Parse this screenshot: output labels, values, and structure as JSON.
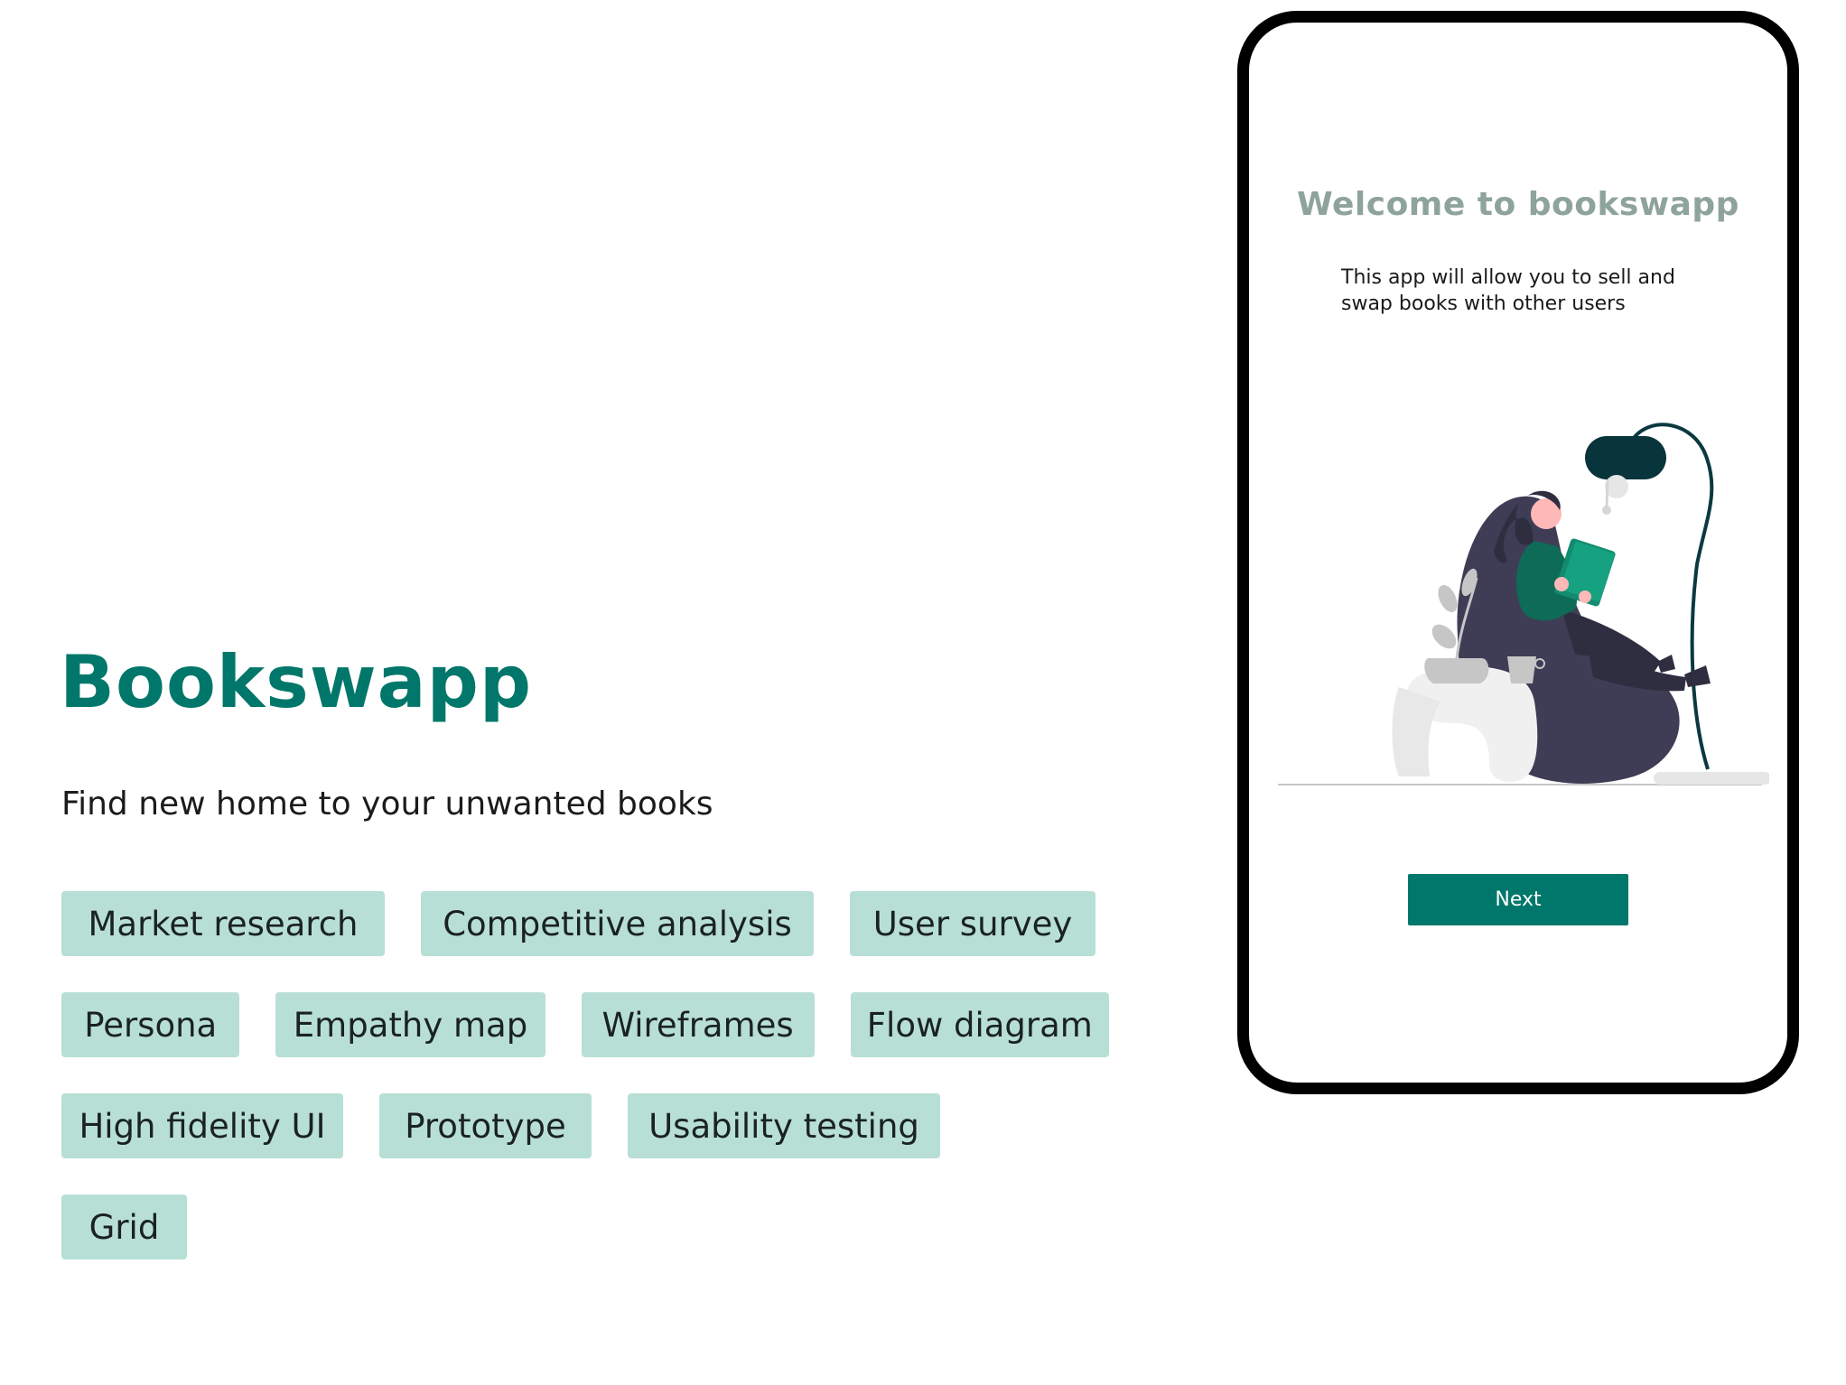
{
  "project": {
    "title": "Bookswapp",
    "subtitle": "Find new home to your unwanted books"
  },
  "tags": [
    [
      "Market research",
      "Competitive analysis",
      "User survey"
    ],
    [
      "Persona",
      "Empathy map",
      "Wireframes",
      "Flow diagram"
    ],
    [
      "High fidelity UI",
      "Prototype",
      "Usability testing"
    ],
    [
      "Grid"
    ]
  ],
  "phone": {
    "welcome_title": "Welcome to bookswapp",
    "description": "This app will allow you to sell and swap books with other users",
    "illustration": "woman-reading-in-beanbag-illustration",
    "next_label": "Next"
  },
  "colors": {
    "brand": "#00776a",
    "tag_bg": "#b8dfd6",
    "welcome_title": "#8fa39d",
    "phone_frame": "#000000",
    "beanbag": "#3f3d56",
    "book": "#128b6f"
  }
}
